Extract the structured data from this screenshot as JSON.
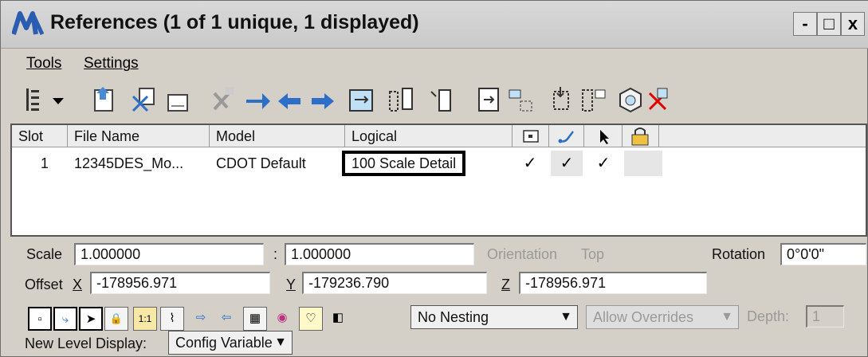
{
  "window": {
    "title": "References (1 of 1 unique, 1 displayed)",
    "controls": {
      "minimize": "-",
      "maximize": "□",
      "close": "x"
    }
  },
  "menu": [
    "Tools",
    "Settings"
  ],
  "toolbar": {
    "icons": [
      "tree-view-icon",
      "dropdown-arrow-icon",
      "attach-reference-icon",
      "detach-reference-icon",
      "reload-reference-icon",
      "exchange-icon",
      "move-reference-icon",
      "scale-reference-icon",
      "rotate-reference-icon",
      "merge-icon",
      "mirror-horizontal-icon",
      "mirror-vertical-icon",
      "clip-boundary-icon",
      "clip-mask-icon",
      "clip-delete-icon",
      "clip-front-icon",
      "clip-back-icon",
      "set-display-icon",
      "delete-reference-icon"
    ]
  },
  "table": {
    "columns": [
      "Slot",
      "File Name",
      "Model",
      "Logical"
    ],
    "icon_columns": [
      "display-icon",
      "snap-icon",
      "locate-icon",
      "lock-icon"
    ],
    "rows": [
      {
        "slot": "1",
        "file_name": "12345DES_Mo...",
        "model": "CDOT Default",
        "logical": "100 Scale Detail",
        "display": "✓",
        "snap": "✓",
        "locate": "✓",
        "lock": ""
      }
    ]
  },
  "scale": {
    "label": "Scale",
    "value1": "1.000000",
    "separator": ":",
    "value2": "1.000000"
  },
  "orientation": {
    "label": "Orientation",
    "value": "Top"
  },
  "rotation": {
    "label": "Rotation",
    "value": "0°0'0\""
  },
  "offset": {
    "label": "Offset",
    "x_label": "X",
    "x": "-178956.971",
    "y_label": "Y",
    "y": "-179236.790",
    "z_label": "Z",
    "z": "-178956.971"
  },
  "settings_bar": {
    "icons": [
      "display-toggle-icon",
      "snap-toggle-icon",
      "locate-toggle-icon",
      "lock-toggle-icon",
      "true-scale-icon",
      "scale-line-styles-icon",
      "treat-as-element-icon",
      "ignore-attach-icon",
      "raster-icon",
      "plot-icon",
      "light-bulb-icon",
      "notes-icon"
    ],
    "icon_glyphs": [
      "▫",
      "⤷",
      "➤",
      "🔒",
      "1:1",
      "⌇",
      "⇨",
      "⇦",
      "▦",
      "◉",
      "♡",
      "◧"
    ],
    "nesting": "No Nesting",
    "overrides": "Allow Overrides",
    "depth_label": "Depth:",
    "depth_value": "1"
  },
  "level_display": {
    "label": "New Level Display:",
    "value": "Config Variable"
  }
}
